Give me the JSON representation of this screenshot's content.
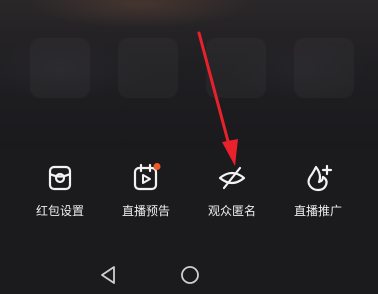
{
  "actions": [
    {
      "label": "红包设置",
      "icon": "red-packet-icon"
    },
    {
      "label": "直播预告",
      "icon": "live-preview-icon",
      "notification_dot": true
    },
    {
      "label": "观众匿名",
      "icon": "eye-off-icon"
    },
    {
      "label": "直播推广",
      "icon": "promotion-icon"
    }
  ],
  "colors": {
    "panel_background": "#1b1a1d",
    "icon_stroke": "#f2f2f2",
    "notification_dot": "#f05a28",
    "annotation_arrow": "#e8212b"
  },
  "system_nav": [
    {
      "icon": "back-triangle-icon"
    },
    {
      "icon": "home-circle-icon"
    }
  ]
}
